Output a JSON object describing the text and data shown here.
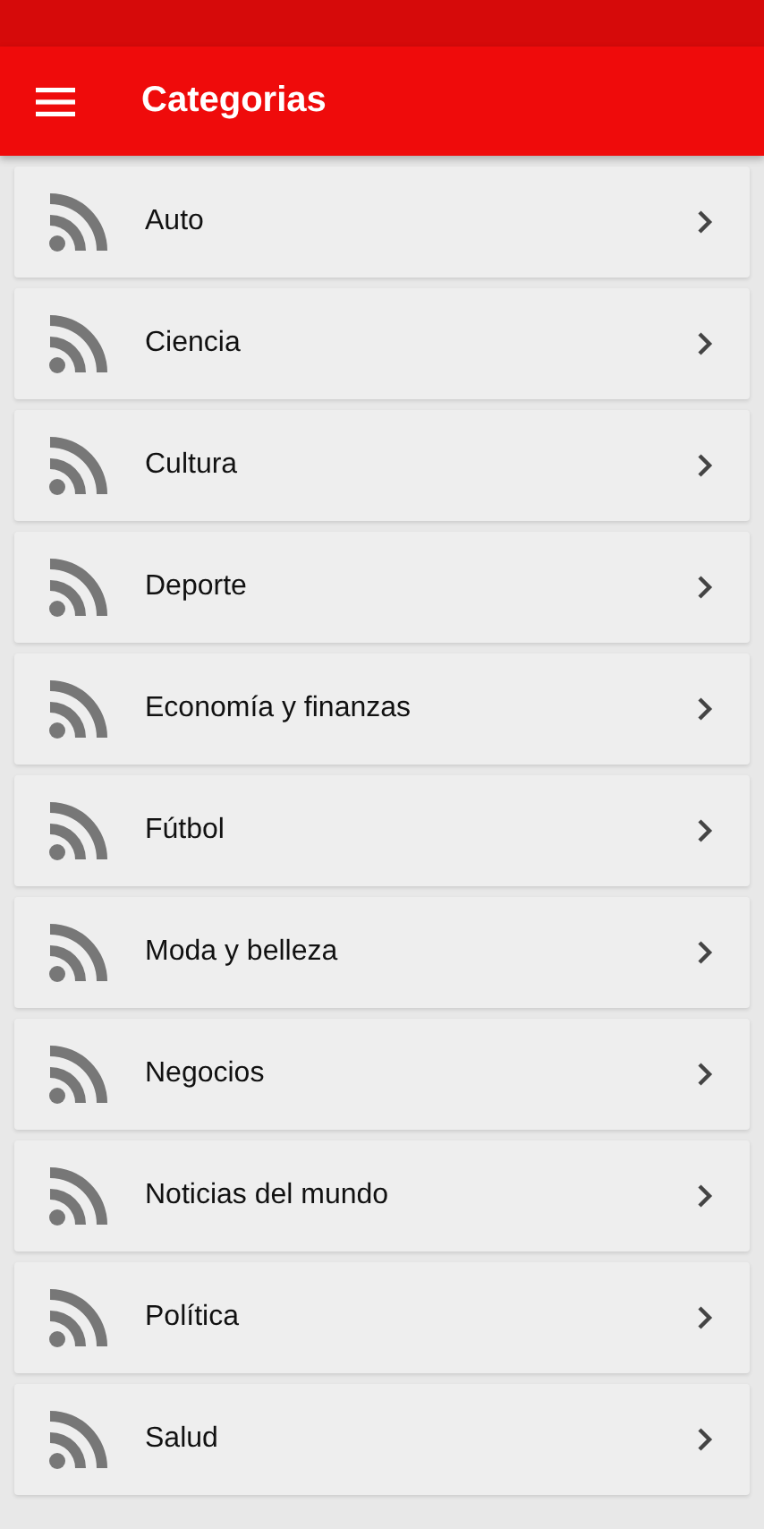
{
  "app_bar": {
    "title": "Categorias"
  },
  "categories": [
    {
      "label": "Auto"
    },
    {
      "label": "Ciencia"
    },
    {
      "label": "Cultura"
    },
    {
      "label": "Deporte"
    },
    {
      "label": "Economía y finanzas"
    },
    {
      "label": "Fútbol"
    },
    {
      "label": "Moda y belleza"
    },
    {
      "label": "Negocios"
    },
    {
      "label": "Noticias del mundo"
    },
    {
      "label": "Política"
    },
    {
      "label": "Salud"
    }
  ]
}
